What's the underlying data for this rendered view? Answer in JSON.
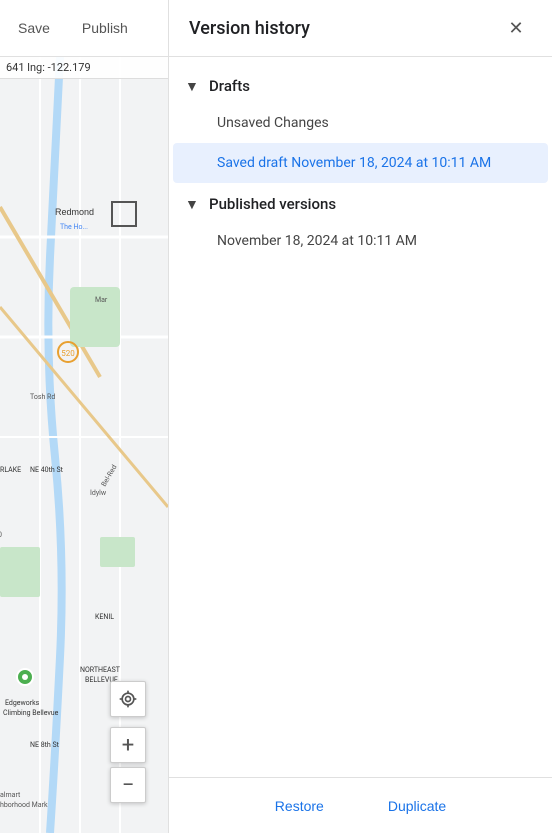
{
  "toolbar": {
    "save_label": "Save",
    "publish_label": "Publish"
  },
  "map": {
    "coords_text": "641  lng: -122.179",
    "label": "Map area showing Redmond/Bellevue WA region",
    "locate_icon": "⊕",
    "zoom_in_icon": "+",
    "zoom_out_icon": "−"
  },
  "panel": {
    "title": "Version history",
    "close_icon": "✕",
    "drafts_section": {
      "label": "Drafts",
      "arrow": "▼",
      "items": [
        {
          "label": "Unsaved Changes",
          "selected": false
        },
        {
          "label": "Saved draft November 18, 2024 at 10:11 AM",
          "selected": true
        }
      ]
    },
    "published_section": {
      "label": "Published versions",
      "arrow": "▼",
      "items": [
        {
          "label": "November 18, 2024 at 10:11 AM",
          "selected": false
        }
      ]
    },
    "footer": {
      "restore_label": "Restore",
      "duplicate_label": "Duplicate"
    }
  }
}
